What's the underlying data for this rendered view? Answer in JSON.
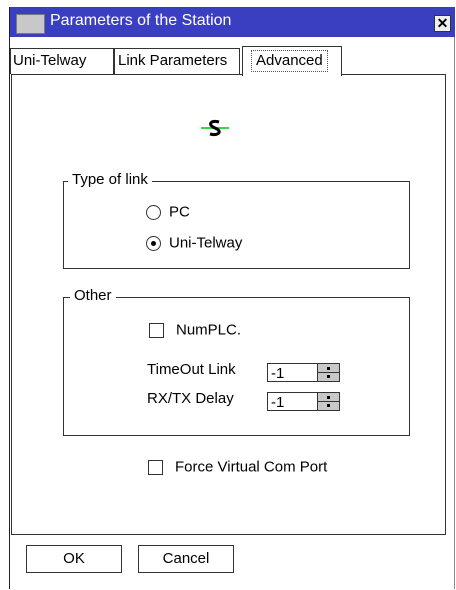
{
  "window": {
    "title": "Parameters of the Station",
    "close_label": "✕"
  },
  "tabs": [
    {
      "label": "Uni-Telway"
    },
    {
      "label": "Link Parameters"
    },
    {
      "label": "Advanced",
      "selected": true
    }
  ],
  "link_icon": "connection-icon",
  "type_of_link": {
    "label": "Type of link",
    "options": [
      {
        "label": "PC",
        "checked": false
      },
      {
        "label": "Uni-Telway",
        "checked": true
      }
    ]
  },
  "other": {
    "label": "Other",
    "numplc": {
      "label": "NumPLC.",
      "checked": false
    },
    "timeout_link": {
      "label": "TimeOut Link",
      "value": "-1"
    },
    "rxtx_delay": {
      "label": "RX/TX Delay",
      "value": "-1"
    }
  },
  "force_virtual_com": {
    "label": "Force Virtual Com Port",
    "checked": false
  },
  "buttons": {
    "ok": "OK",
    "cancel": "Cancel"
  },
  "colors": {
    "titlebar": "#3a3fc2",
    "icon_green": "#3cd24a"
  }
}
